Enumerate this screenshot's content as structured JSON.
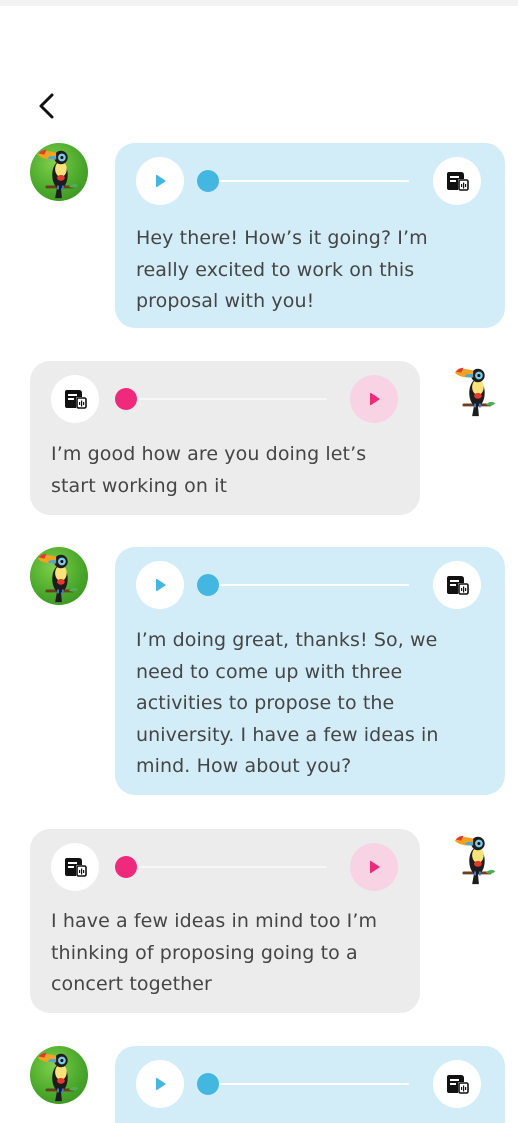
{
  "header": {
    "back_icon": "chevron-left-icon"
  },
  "colors": {
    "bot_bubble": "#d2edf8",
    "user_bubble": "#ececec",
    "bot_accent": "#44b7e0",
    "user_accent": "#ef2a7c",
    "user_play_bg": "#f7d3e3",
    "text": "#454545"
  },
  "icons": {
    "play": "play-icon",
    "transcript": "transcript-icon",
    "avatar": "toucan-avatar"
  },
  "messages": [
    {
      "sender": "bot",
      "lines": [
        "Hey there! How’s it going? I’m",
        "really excited to work on this",
        "proposal with you!"
      ]
    },
    {
      "sender": "user",
      "lines": [
        "I’m good how are you doing let’s",
        "start working on it"
      ]
    },
    {
      "sender": "bot",
      "lines": [
        "I’m doing great, thanks! So, we",
        "need to come up with three",
        "activities to propose to the",
        "university. I have a few ideas in",
        "mind. How about you?"
      ]
    },
    {
      "sender": "user",
      "lines": [
        "I have a few ideas in mind too I’m",
        "thinking of proposing going to a",
        "concert together"
      ]
    },
    {
      "sender": "bot",
      "lines": []
    }
  ]
}
